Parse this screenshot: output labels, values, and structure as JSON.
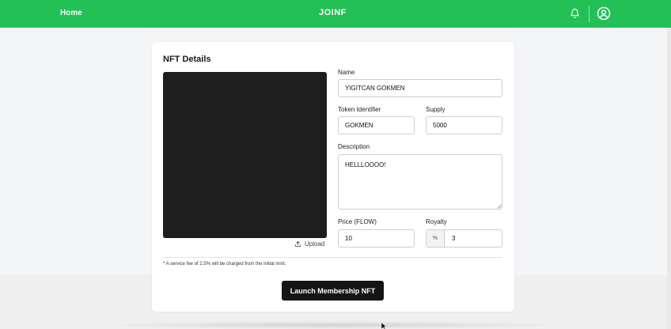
{
  "header": {
    "home_label": "Home",
    "brand": "JOINF",
    "icons": [
      "bell-icon",
      "account-circle-icon"
    ],
    "accent_color": "#22c055"
  },
  "card": {
    "title": "NFT Details",
    "upload_label": "Upload",
    "fields": {
      "name": {
        "label": "Name",
        "value": "YIGITCAN GOKMEN"
      },
      "token_identifier": {
        "label": "Token Identifier",
        "value": "GOKMEN"
      },
      "supply": {
        "label": "Supply",
        "value": "5000"
      },
      "description": {
        "label": "Description",
        "value": "HELLLOOOO!"
      },
      "price": {
        "label": "Price (FLOW)",
        "value": "10"
      },
      "royalty": {
        "label": "Royalty",
        "prefix": "%",
        "value": "3"
      }
    },
    "fee_note": "* A service fee of 2.5% will be charged from the initial mint.",
    "launch_label": "Launch Membership NFT"
  }
}
